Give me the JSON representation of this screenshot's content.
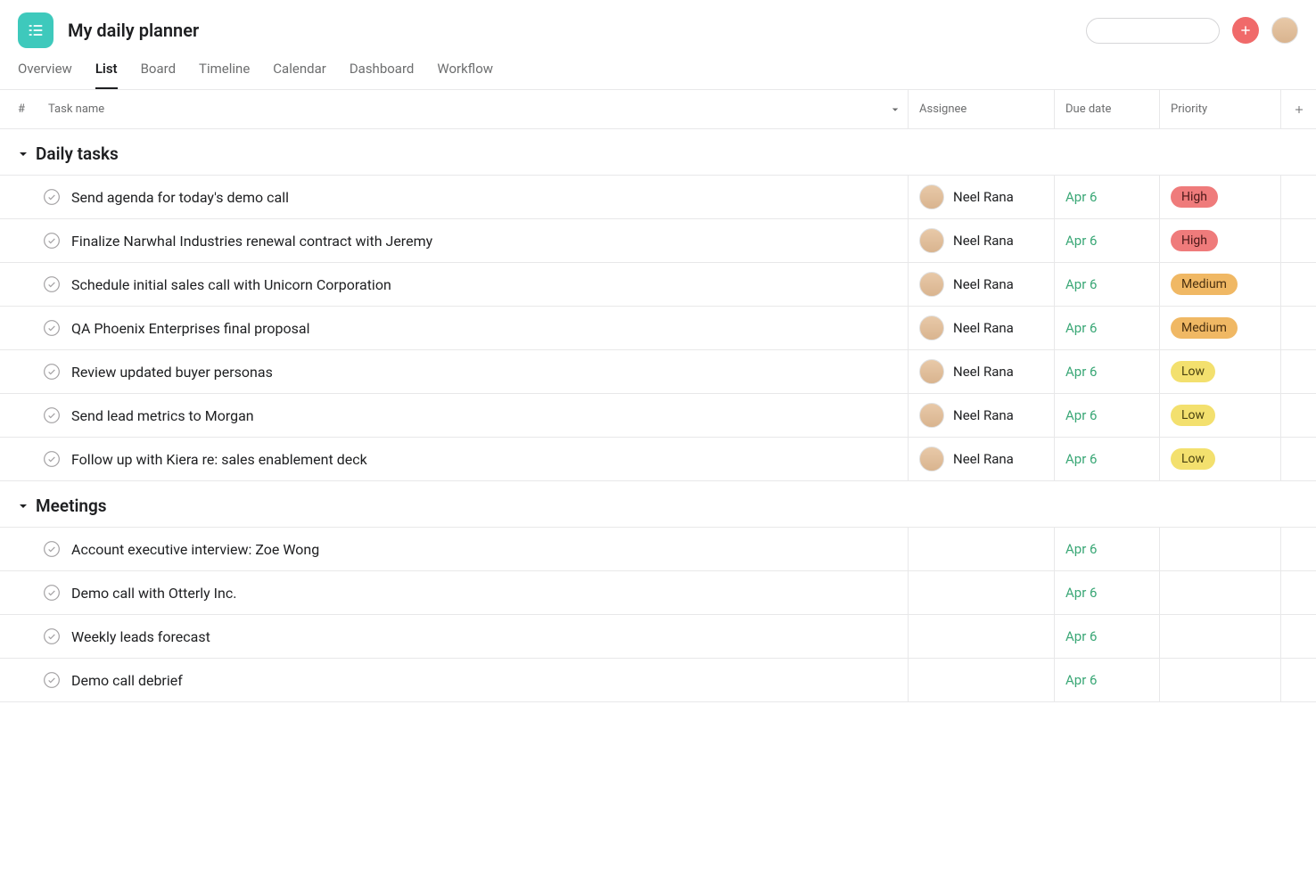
{
  "project": {
    "title": "My daily planner"
  },
  "tabs": [
    {
      "label": "Overview"
    },
    {
      "label": "List"
    },
    {
      "label": "Board"
    },
    {
      "label": "Timeline"
    },
    {
      "label": "Calendar"
    },
    {
      "label": "Dashboard"
    },
    {
      "label": "Workflow"
    }
  ],
  "tabs_active_index": 1,
  "columns": {
    "num": "#",
    "task": "Task name",
    "assignee": "Assignee",
    "due": "Due date",
    "priority": "Priority"
  },
  "sections": [
    {
      "name": "Daily tasks",
      "tasks": [
        {
          "title": "Send agenda for today's demo call",
          "assignee": "Neel Rana",
          "due": "Apr 6",
          "priority": "High",
          "priority_class": "high"
        },
        {
          "title": "Finalize Narwhal Industries renewal contract with Jeremy",
          "assignee": "Neel Rana",
          "due": "Apr 6",
          "priority": "High",
          "priority_class": "high"
        },
        {
          "title": "Schedule initial sales call with Unicorn Corporation",
          "assignee": "Neel Rana",
          "due": "Apr 6",
          "priority": "Medium",
          "priority_class": "medium"
        },
        {
          "title": "QA Phoenix Enterprises final proposal",
          "assignee": "Neel Rana",
          "due": "Apr 6",
          "priority": "Medium",
          "priority_class": "medium"
        },
        {
          "title": "Review updated buyer personas",
          "assignee": "Neel Rana",
          "due": "Apr 6",
          "priority": "Low",
          "priority_class": "low"
        },
        {
          "title": "Send lead metrics to Morgan",
          "assignee": "Neel Rana",
          "due": "Apr 6",
          "priority": "Low",
          "priority_class": "low"
        },
        {
          "title": "Follow up with Kiera re: sales enablement deck",
          "assignee": "Neel Rana",
          "due": "Apr 6",
          "priority": "Low",
          "priority_class": "low"
        }
      ]
    },
    {
      "name": "Meetings",
      "tasks": [
        {
          "title": "Account executive interview: Zoe Wong",
          "assignee": "",
          "due": "Apr 6",
          "priority": "",
          "priority_class": ""
        },
        {
          "title": "Demo call with Otterly Inc.",
          "assignee": "",
          "due": "Apr 6",
          "priority": "",
          "priority_class": ""
        },
        {
          "title": "Weekly leads forecast",
          "assignee": "",
          "due": "Apr 6",
          "priority": "",
          "priority_class": ""
        },
        {
          "title": "Demo call debrief",
          "assignee": "",
          "due": "Apr 6",
          "priority": "",
          "priority_class": ""
        }
      ]
    }
  ]
}
